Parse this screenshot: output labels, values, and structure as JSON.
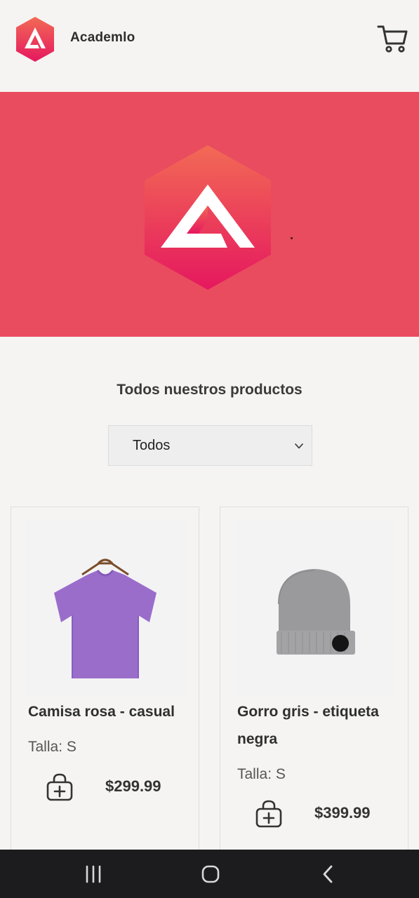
{
  "header": {
    "brand_name": "Academlo",
    "logo_icon": "academlo-logo",
    "cart_icon": "cart-icon"
  },
  "hero": {
    "logo_icon": "academlo-logo",
    "background": "#e94c5e"
  },
  "catalog": {
    "title": "Todos nuestros productos",
    "filter": {
      "selected": "Todos"
    }
  },
  "products": [
    {
      "name": "Camisa rosa - casual",
      "size": "Talla: S",
      "price": "$299.99",
      "image_icon": "purple-tshirt-image"
    },
    {
      "name": "Gorro gris - etiqueta negra",
      "size": "Talla: S",
      "price": "$399.99",
      "image_icon": "gray-beanie-image"
    }
  ],
  "nav": {
    "recent_icon": "recent-apps-icon",
    "home_icon": "home-icon",
    "back_icon": "back-icon"
  },
  "colors": {
    "brand_red": "#e94c5e",
    "logo_gradient_top": "#f26a55",
    "logo_gradient_bottom": "#e5185f",
    "page_bg": "#f5f4f2",
    "navbar_bg": "#1c1c1e"
  }
}
